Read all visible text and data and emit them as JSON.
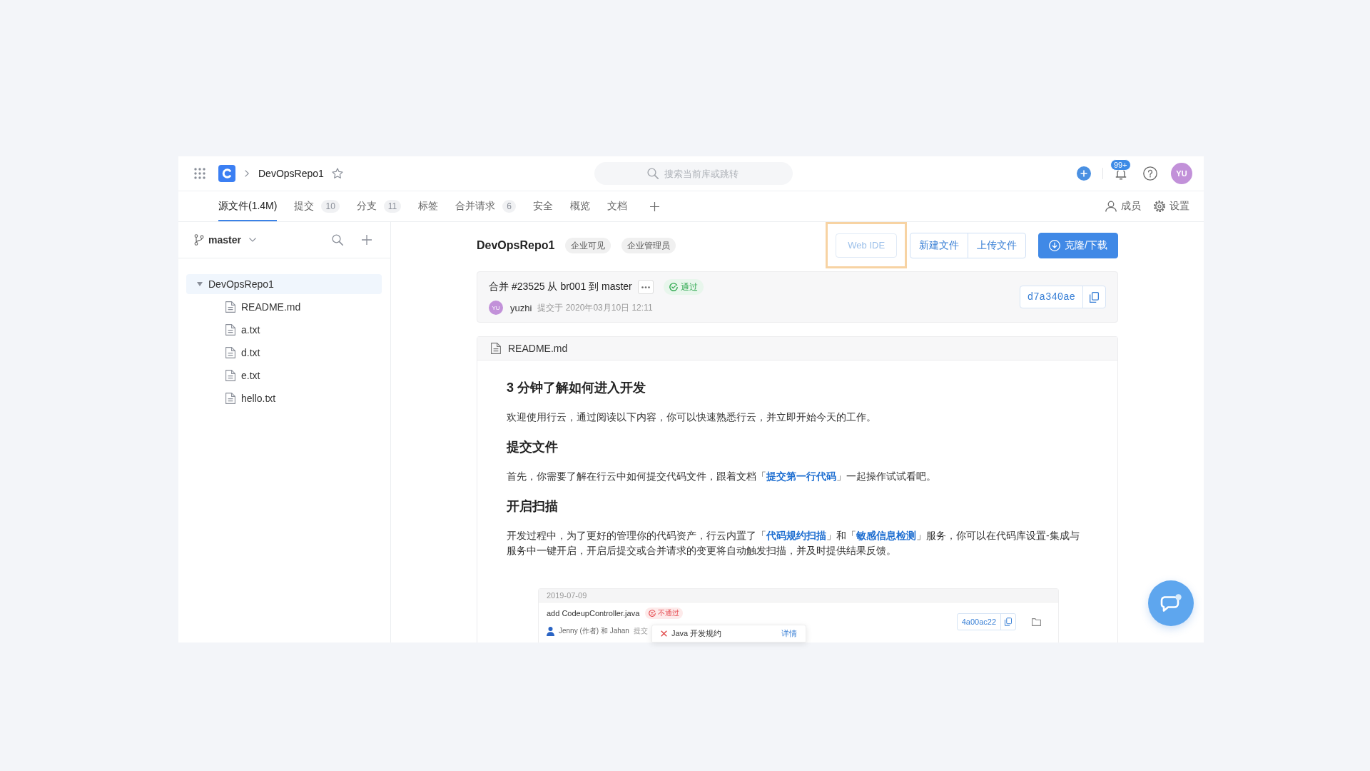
{
  "header": {
    "repo": "DevOpsRepo1",
    "starred": false,
    "search": {
      "placeholder": "搜索当前库或跳转"
    },
    "notification_badge": "99+",
    "avatar": "YU"
  },
  "tabs": [
    {
      "label": "源文件(1.4M)",
      "selected": true
    },
    {
      "label": "提交",
      "count": "10",
      "selected": false
    },
    {
      "label": "分支",
      "count": "11",
      "selected": false
    },
    {
      "label": "标签",
      "selected": false
    },
    {
      "label": "合并请求",
      "count": "6",
      "selected": false
    },
    {
      "label": "安全",
      "selected": false
    },
    {
      "label": "概览",
      "selected": false
    },
    {
      "label": "文档",
      "selected": false
    }
  ],
  "tab_links": [
    {
      "kind": "members",
      "label": "成员"
    },
    {
      "kind": "settings",
      "label": "设置"
    }
  ],
  "sidebar": {
    "branch": "master",
    "tree": [
      {
        "name": "DevOpsRepo1",
        "kind": "folder",
        "expanded": true,
        "selected": true,
        "children": [
          {
            "name": "README.md",
            "kind": "file",
            "selected": false
          },
          {
            "name": "a.txt",
            "kind": "file",
            "selected": false
          },
          {
            "name": "d.txt",
            "kind": "file",
            "selected": false
          },
          {
            "name": "e.txt",
            "kind": "file",
            "selected": false
          },
          {
            "name": "hello.txt",
            "kind": "file",
            "selected": false
          }
        ]
      }
    ]
  },
  "repo": {
    "name": "DevOpsRepo1",
    "tags": [
      "企业可见",
      "企业管理员"
    ]
  },
  "actions": [
    {
      "label": "Web IDE",
      "kind": "outline",
      "disabled": true,
      "highlighted": true
    },
    {
      "label": "新建文件",
      "kind": "group",
      "disabled": false,
      "highlighted": false
    },
    {
      "label": "上传文件",
      "kind": "group",
      "disabled": false,
      "highlighted": false
    },
    {
      "label": "克隆/下载",
      "kind": "primary",
      "disabled": false,
      "highlighted": false
    }
  ],
  "latest_commit": {
    "title": "合并 #23525 从 br001 到 master",
    "status": {
      "kind": "passed",
      "label": "通过"
    },
    "avatar": "YU",
    "author": "yuzhi",
    "meta": "提交于 2020年03月10日 12:11",
    "hash": "d7a340ae"
  },
  "readme": {
    "filename": "README.md",
    "blocks": [
      {
        "kind": "heading",
        "text": "3 分钟了解如何进入开发"
      },
      {
        "kind": "paragraph",
        "parts": [
          {
            "kind": "text",
            "text": "欢迎使用行云，通过阅读以下内容，你可以快速熟悉行云，并立即开始今天的工作。"
          }
        ]
      },
      {
        "kind": "heading",
        "text": "提交文件"
      },
      {
        "kind": "paragraph",
        "parts": [
          {
            "kind": "text",
            "text": "首先，你需要了解在行云中如何提交代码文件，跟着文档「"
          },
          {
            "kind": "link",
            "text": "提交第一行代码"
          },
          {
            "kind": "text",
            "text": "」一起操作试试看吧。"
          }
        ]
      },
      {
        "kind": "heading",
        "text": "开启扫描"
      },
      {
        "kind": "paragraph",
        "parts": [
          {
            "kind": "text",
            "text": "开发过程中，为了更好的管理你的代码资产，行云内置了「"
          },
          {
            "kind": "link",
            "text": "代码规约扫描"
          },
          {
            "kind": "text",
            "text": "」和「"
          },
          {
            "kind": "link",
            "text": "敏感信息检测"
          },
          {
            "kind": "text",
            "text": "」服务，你可以在代码库设置-集成与服务中一键开启，开启后提交或合并请求的变更将自动触发扫描，并及时提供结果反馈。"
          }
        ]
      }
    ],
    "preview": {
      "date": "2019-07-09",
      "title": "add CodeupController.java",
      "status": {
        "kind": "failed",
        "label": "不通过"
      },
      "authors": "Jenny (作者) 和 Jahan",
      "action": "提交",
      "hash": "4a00ac22",
      "popup": {
        "rule": "Java 开发规约",
        "link": "详情"
      }
    }
  }
}
